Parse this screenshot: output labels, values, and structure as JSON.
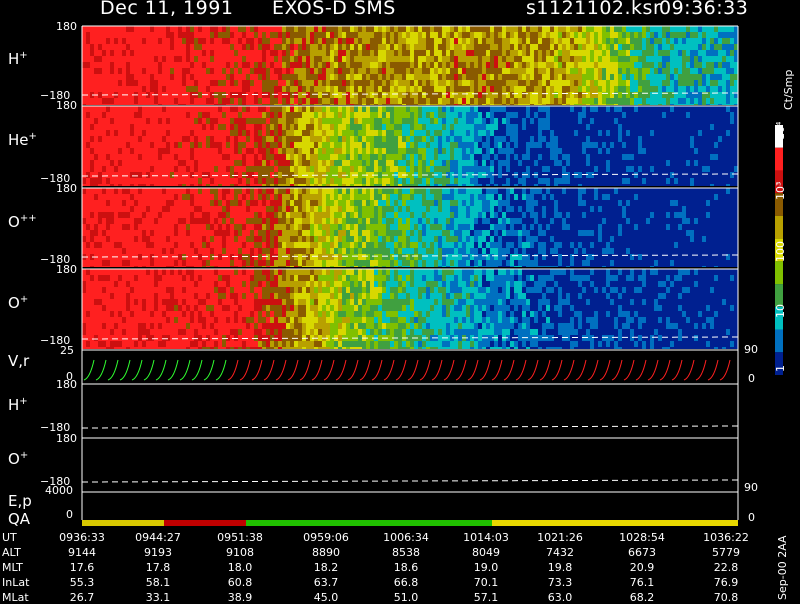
{
  "header": {
    "date": "Dec 11, 1991",
    "instrument": "EXOS-D SMS",
    "file": "s1121102.ksr",
    "time": "09:36:33"
  },
  "panels": [
    {
      "label": "H",
      "sup": "+",
      "ymax": "180",
      "ymin": "−180"
    },
    {
      "label": "He",
      "sup": "+",
      "ymax": "180",
      "ymin": "−180"
    },
    {
      "label": "O",
      "sup": "++",
      "ymax": "180",
      "ymin": "−180"
    },
    {
      "label": "O",
      "sup": "+",
      "ymax": "180",
      "ymin": "−180"
    }
  ],
  "lower_panels": {
    "vr": {
      "label": "V,r",
      "ymax": "25",
      "ymin": "0",
      "right_top": "90",
      "right_bottom": "0"
    },
    "h": {
      "label": "H",
      "sup": "+",
      "ymax": "180",
      "ymin": "−180"
    },
    "o": {
      "label": "O",
      "sup": "+",
      "ymax": "180",
      "ymin": "−180"
    },
    "ep": {
      "label": "E,p",
      "ymax": "4000",
      "ymin": "0",
      "right_top": "90",
      "right_bottom": "0"
    },
    "qa": {
      "label": "QA"
    }
  },
  "colorbar": {
    "title": "Ct/Smp",
    "ticks": [
      "10⁴",
      "10³",
      "100",
      "10",
      "1"
    ],
    "colors": [
      "#ffffff",
      "#ff2020",
      "#cc1010",
      "#8a5a00",
      "#b8a000",
      "#d8d800",
      "#80c000",
      "#40a040",
      "#00c0c0",
      "#0070c0",
      "#002090"
    ]
  },
  "footer": {
    "row_labels": [
      "UT",
      "ALT",
      "MLT",
      "InLat",
      "MLat"
    ],
    "columns": [
      [
        "0936:33",
        "9144",
        "17.6",
        "55.3",
        "26.7"
      ],
      [
        "0944:27",
        "9193",
        "17.8",
        "58.1",
        "33.1"
      ],
      [
        "0951:38",
        "9108",
        "18.0",
        "60.8",
        "38.9"
      ],
      [
        "0959:06",
        "8890",
        "18.2",
        "63.7",
        "45.0"
      ],
      [
        "1006:34",
        "8538",
        "18.6",
        "66.8",
        "51.0"
      ],
      [
        "1014:03",
        "8049",
        "19.0",
        "70.1",
        "57.1"
      ],
      [
        "1021:26",
        "7432",
        "19.8",
        "73.3",
        "63.0"
      ],
      [
        "1028:54",
        "6673",
        "20.9",
        "76.1",
        "68.2"
      ],
      [
        "1036:22",
        "5779",
        "22.8",
        "76.9",
        "70.8"
      ]
    ],
    "version": "Sep-00 2AA"
  },
  "chart_data": {
    "type": "heatmap",
    "title": "Dec 11, 1991 EXOS-D SMS",
    "x_ticks": [
      "0936:33",
      "0944:27",
      "0951:38",
      "0959:06",
      "1006:34",
      "1014:03",
      "1021:26",
      "1028:54",
      "1036:22"
    ],
    "ylim": [
      -180,
      180
    ],
    "color_scale": "log",
    "color_range": [
      1,
      10000
    ],
    "series": [
      {
        "name": "H+",
        "level_profile": [
          3.2,
          3.2,
          3.0,
          2.5,
          2.4,
          2.5,
          2.2,
          1.2,
          1.0
        ]
      },
      {
        "name": "He+",
        "level_profile": [
          3.2,
          3.2,
          3.0,
          2.0,
          1.5,
          0.6,
          0.3,
          0.2,
          0.2
        ]
      },
      {
        "name": "O++",
        "level_profile": [
          3.2,
          3.2,
          3.0,
          2.0,
          1.3,
          0.7,
          0.3,
          0.2,
          0.2
        ]
      },
      {
        "name": "O+",
        "level_profile": [
          3.2,
          3.2,
          3.0,
          2.0,
          1.3,
          0.8,
          0.4,
          0.3,
          0.2
        ]
      }
    ],
    "qa_segments": [
      {
        "from": "0936:33",
        "to": "0944:27",
        "color": "#d8c800"
      },
      {
        "from": "0944:27",
        "to": "0951:38",
        "color": "#c00000"
      },
      {
        "from": "0951:38",
        "to": "1014:03",
        "color": "#20c000"
      },
      {
        "from": "1014:03",
        "to": "1036:22",
        "color": "#e8d800"
      }
    ]
  }
}
